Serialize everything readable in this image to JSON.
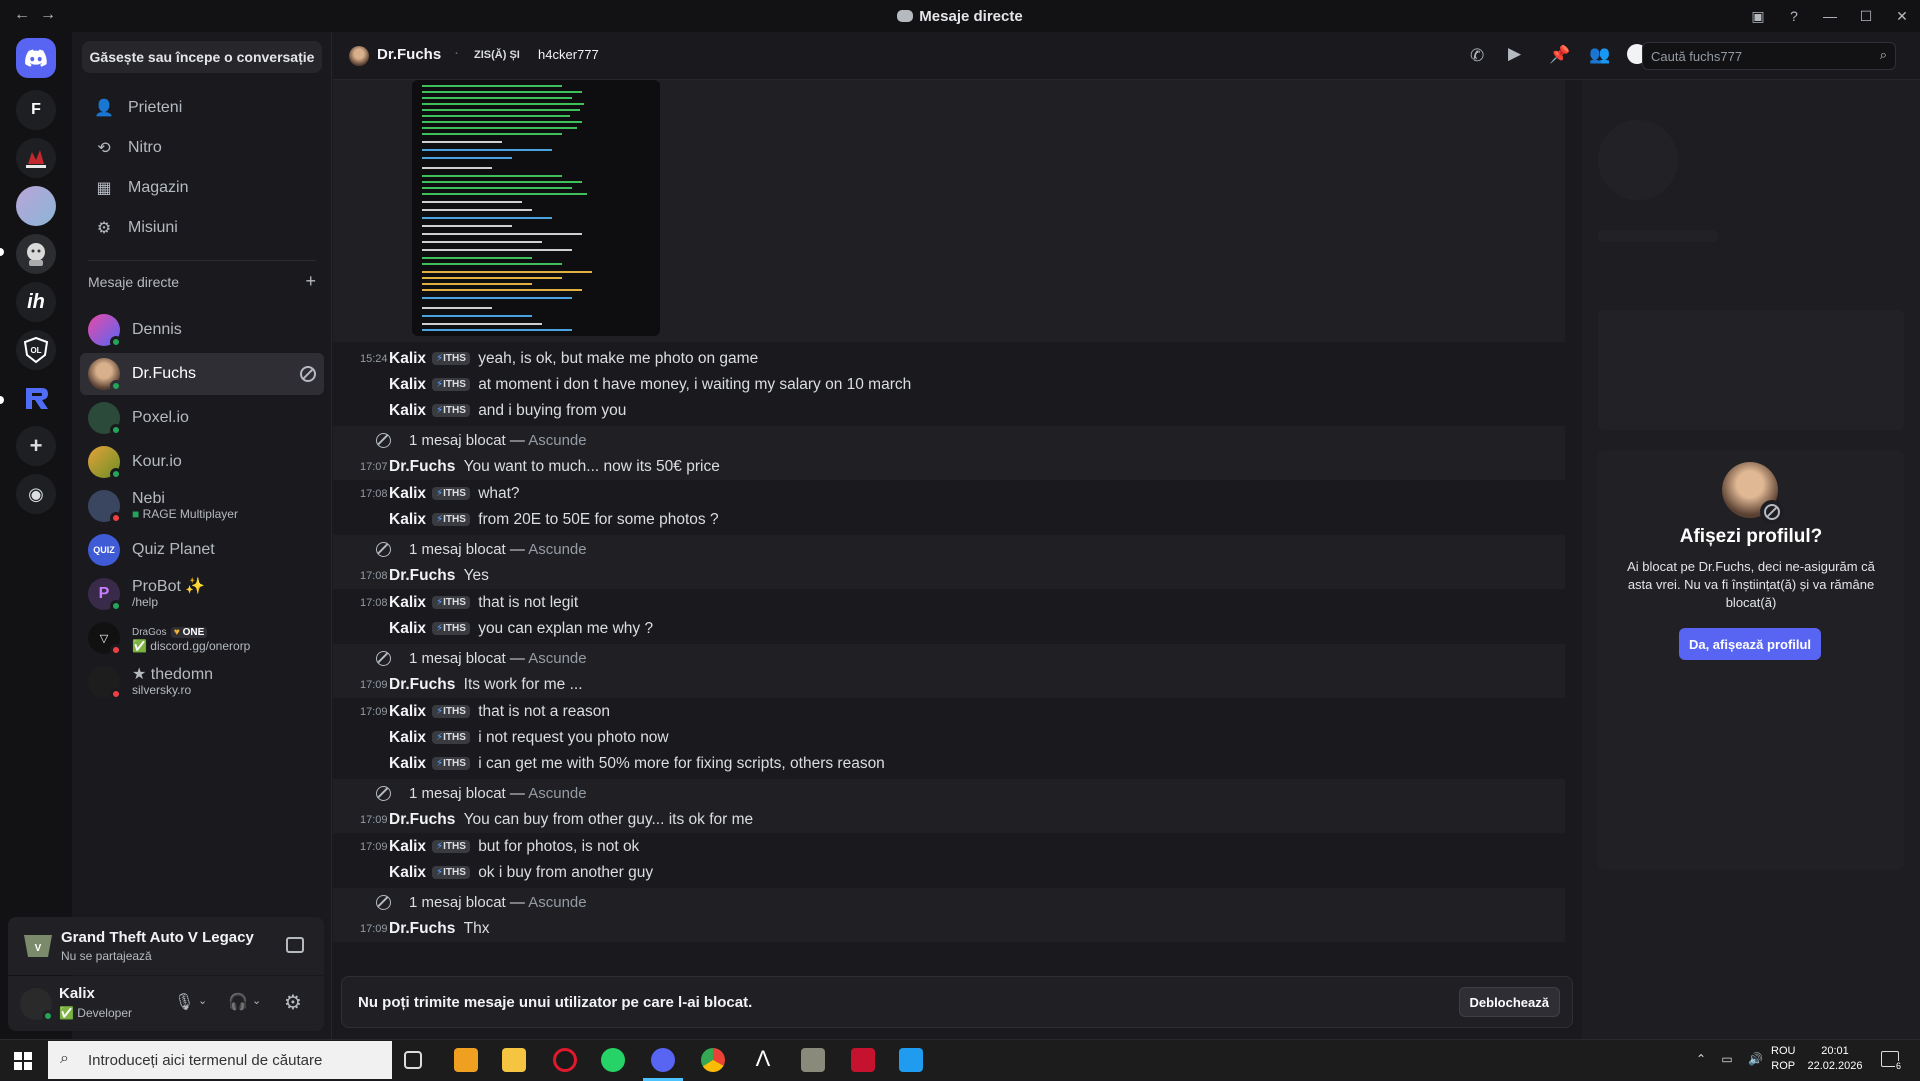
{
  "window": {
    "title": "Mesaje directe",
    "nav_back": "←",
    "nav_forward": "→"
  },
  "colors": {
    "accent": "#5865f2",
    "background": "#1a1a1e",
    "rail": "#121214",
    "online": "#23a55a",
    "dnd": "#f23f43"
  },
  "rail": {
    "servers": [
      "F",
      "BEZMOGO",
      "avatar",
      "dog",
      "ih",
      "OL",
      "R"
    ]
  },
  "sidebar": {
    "find_button": "Găsește sau începe o conversație",
    "nav": [
      {
        "label": "Prieteni",
        "icon": "friends-icon"
      },
      {
        "label": "Nitro",
        "icon": "nitro-icon"
      },
      {
        "label": "Magazin",
        "icon": "shop-icon"
      },
      {
        "label": "Misiuni",
        "icon": "quests-icon"
      }
    ],
    "dm_header": "Mesaje directe",
    "dm_add": "+",
    "dms": [
      {
        "name": "Dennis",
        "sub": "",
        "status": "online"
      },
      {
        "name": "Dr.Fuchs",
        "sub": "",
        "status": "online"
      },
      {
        "name": "Poxel.io",
        "sub": "",
        "status": "online"
      },
      {
        "name": "Kour.io",
        "sub": "",
        "status": "online"
      },
      {
        "name": "Nebi",
        "sub": "RAGE Multiplayer",
        "status": "dnd"
      },
      {
        "name": "Quiz Planet",
        "sub": "",
        "status": "none"
      },
      {
        "name": "ProBot ✨",
        "sub": "/help",
        "status": "online"
      },
      {
        "name": "DraGos",
        "badge": "ONE",
        "sub": "discord.gg/onerorp",
        "status": "dnd"
      },
      {
        "name": "★ thedomn",
        "sub": "silversky.ro",
        "status": "dnd"
      }
    ]
  },
  "activity": {
    "game": "Grand Theft Auto V Legacy",
    "sub": "Nu se partajează"
  },
  "user": {
    "name": "Kalix",
    "status": "Developer"
  },
  "header": {
    "name": "Dr.Fuchs",
    "said": "ZIS(Ă) ȘI",
    "alias": "h4cker777",
    "search_placeholder": "Caută fuchs777"
  },
  "messages": {
    "tag": "ITHS",
    "blocked_text": "1 mesaj blocat —",
    "hide": "Ascunde",
    "rows": [
      {
        "type": "msg",
        "time": "15:24",
        "author": "Kalix",
        "tag": true,
        "text": "yeah, is ok, but make me photo on game"
      },
      {
        "type": "msg",
        "time": "",
        "author": "Kalix",
        "tag": true,
        "text": "at moment i don t have money, i waiting my salary on 10 march"
      },
      {
        "type": "msg",
        "time": "",
        "author": "Kalix",
        "tag": true,
        "text": "and i buying from you"
      },
      {
        "type": "blocked"
      },
      {
        "type": "msg",
        "time": "17:07",
        "author": "Dr.Fuchs",
        "tag": false,
        "text": "You want to much... now its 50€ price",
        "hl": true
      },
      {
        "type": "msg",
        "time": "17:08",
        "author": "Kalix",
        "tag": true,
        "text": "what?"
      },
      {
        "type": "msg",
        "time": "",
        "author": "Kalix",
        "tag": true,
        "text": "from 20E to 50E for some photos ?"
      },
      {
        "type": "blocked"
      },
      {
        "type": "msg",
        "time": "17:08",
        "author": "Dr.Fuchs",
        "tag": false,
        "text": "Yes",
        "hl": true
      },
      {
        "type": "msg",
        "time": "17:08",
        "author": "Kalix",
        "tag": true,
        "text": "that is not legit"
      },
      {
        "type": "msg",
        "time": "",
        "author": "Kalix",
        "tag": true,
        "text": "you can explan me why ?"
      },
      {
        "type": "blocked"
      },
      {
        "type": "msg",
        "time": "17:09",
        "author": "Dr.Fuchs",
        "tag": false,
        "text": "Its work for me ...",
        "hl": true
      },
      {
        "type": "msg",
        "time": "17:09",
        "author": "Kalix",
        "tag": true,
        "text": "that is not a reason"
      },
      {
        "type": "msg",
        "time": "",
        "author": "Kalix",
        "tag": true,
        "text": "i not request you photo now"
      },
      {
        "type": "msg",
        "time": "",
        "author": "Kalix",
        "tag": true,
        "text": "i can get me with 50% more for fixing scripts, others reason"
      },
      {
        "type": "blocked"
      },
      {
        "type": "msg",
        "time": "17:09",
        "author": "Dr.Fuchs",
        "tag": false,
        "text": "You can buy from other guy... its ok for me",
        "hl": true
      },
      {
        "type": "msg",
        "time": "17:09",
        "author": "Kalix",
        "tag": true,
        "text": "but for photos, is not ok"
      },
      {
        "type": "msg",
        "time": "",
        "author": "Kalix",
        "tag": true,
        "text": "ok i buy from another guy"
      },
      {
        "type": "blocked"
      },
      {
        "type": "msg",
        "time": "17:09",
        "author": "Dr.Fuchs",
        "tag": false,
        "text": "Thx",
        "hl": true
      }
    ]
  },
  "footer": {
    "notice": "Nu poți trimite mesaje unui utilizator pe care l-ai blocat.",
    "unblock": "Deblochează"
  },
  "profile_prompt": {
    "title": "Afișezi profilul?",
    "body": "Ai blocat pe Dr.Fuchs, deci ne-asigurăm că asta vrei. Nu va fi înștiințat(ă) și va rămâne blocat(ă)",
    "button": "Da, afișează profilul"
  },
  "taskbar": {
    "search_placeholder": "Introduceți aici termenul de căutare",
    "lang_top": "ROU",
    "lang_bottom": "ROP",
    "time": "20:01",
    "date": "22.02.2026",
    "notif_count": "6"
  }
}
